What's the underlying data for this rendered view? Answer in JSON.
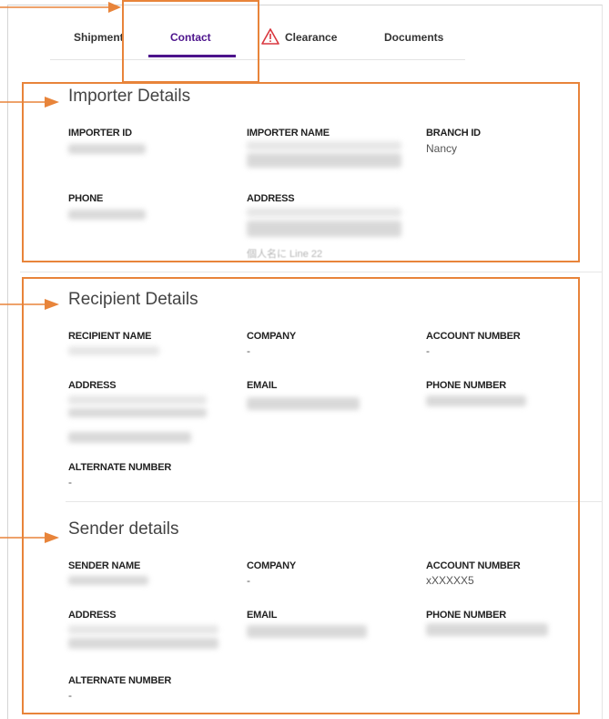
{
  "tabs": [
    {
      "label": "Shipment"
    },
    {
      "label": "Contact"
    },
    {
      "label": "Clearance"
    },
    {
      "label": "Documents"
    }
  ],
  "importer": {
    "title": "Importer Details",
    "importer_id_label": "IMPORTER ID",
    "importer_name_label": "IMPORTER NAME",
    "branch_id_label": "BRANCH ID",
    "branch_id_value": "Nancy",
    "phone_label": "PHONE",
    "address_label": "ADDRESS",
    "address_line_visible": "個人名に Line 22"
  },
  "recipient": {
    "title": "Recipient Details",
    "name_label": "RECIPIENT NAME",
    "company_label": "COMPANY",
    "company_value": "-",
    "account_label": "ACCOUNT NUMBER",
    "account_value": "-",
    "address_label": "ADDRESS",
    "email_label": "EMAIL",
    "phone_label": "PHONE NUMBER",
    "alternate_label": "ALTERNATE NUMBER",
    "alternate_value": "-"
  },
  "sender": {
    "title": "Sender details",
    "name_label": "SENDER NAME",
    "company_label": "COMPANY",
    "company_value": "-",
    "account_label": "ACCOUNT NUMBER",
    "account_value": "xXXXXX5",
    "address_label": "ADDRESS",
    "email_label": "EMAIL",
    "phone_label": "PHONE NUMBER",
    "alternate_label": "ALTERNATE NUMBER",
    "alternate_value": "-"
  },
  "icons": {
    "clearance_warning": "warning-triangle-icon",
    "annotation_arrow": "arrow-right-icon"
  },
  "colors": {
    "accent": "#4d148c",
    "annotation": "#e8843a",
    "warning": "#d9363e"
  }
}
